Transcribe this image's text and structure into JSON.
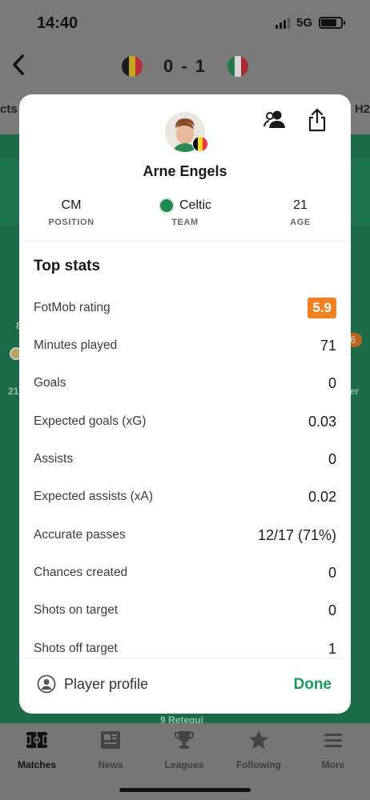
{
  "status_bar": {
    "time": "14:40",
    "network": "5G"
  },
  "match_header": {
    "score": "0 - 1"
  },
  "background_tabs": {
    "left_peek": "cts",
    "right_peek": "H2"
  },
  "background_peek": {
    "left_number": "8",
    "left_text": "21",
    "right_badge": "6",
    "right_text": "er",
    "bottom_text": "9 Retegui"
  },
  "player": {
    "name": "Arne Engels",
    "position_value": "CM",
    "position_label": "POSITION",
    "team_value": "Celtic",
    "team_label": "TEAM",
    "age_value": "21",
    "age_label": "AGE"
  },
  "top_stats": {
    "title": "Top stats",
    "rows": [
      {
        "label": "FotMob rating",
        "value": "5.9"
      },
      {
        "label": "Minutes played",
        "value": "71"
      },
      {
        "label": "Goals",
        "value": "0"
      },
      {
        "label": "Expected goals (xG)",
        "value": "0.03"
      },
      {
        "label": "Assists",
        "value": "0"
      },
      {
        "label": "Expected assists (xA)",
        "value": "0.02"
      },
      {
        "label": "Accurate passes",
        "value": "12/17 (71%)"
      },
      {
        "label": "Chances created",
        "value": "0"
      },
      {
        "label": "Shots on target",
        "value": "0"
      },
      {
        "label": "Shots off target",
        "value": "1"
      }
    ]
  },
  "footer": {
    "profile_label": "Player profile",
    "done_label": "Done"
  },
  "tab_bar": [
    {
      "label": "Matches",
      "icon": "pitch-icon"
    },
    {
      "label": "News",
      "icon": "newspaper-icon"
    },
    {
      "label": "Leagues",
      "icon": "trophy-icon"
    },
    {
      "label": "Following",
      "icon": "star-icon"
    },
    {
      "label": "More",
      "icon": "menu-icon"
    }
  ],
  "colors": {
    "rating_badge": "#f08022",
    "done": "#1b9a5c",
    "pitch_green": "#1b6b48",
    "belgium": [
      "#000000",
      "#fdda24",
      "#ef3340"
    ],
    "italy": [
      "#009246",
      "#ffffff",
      "#ce2b37"
    ]
  }
}
